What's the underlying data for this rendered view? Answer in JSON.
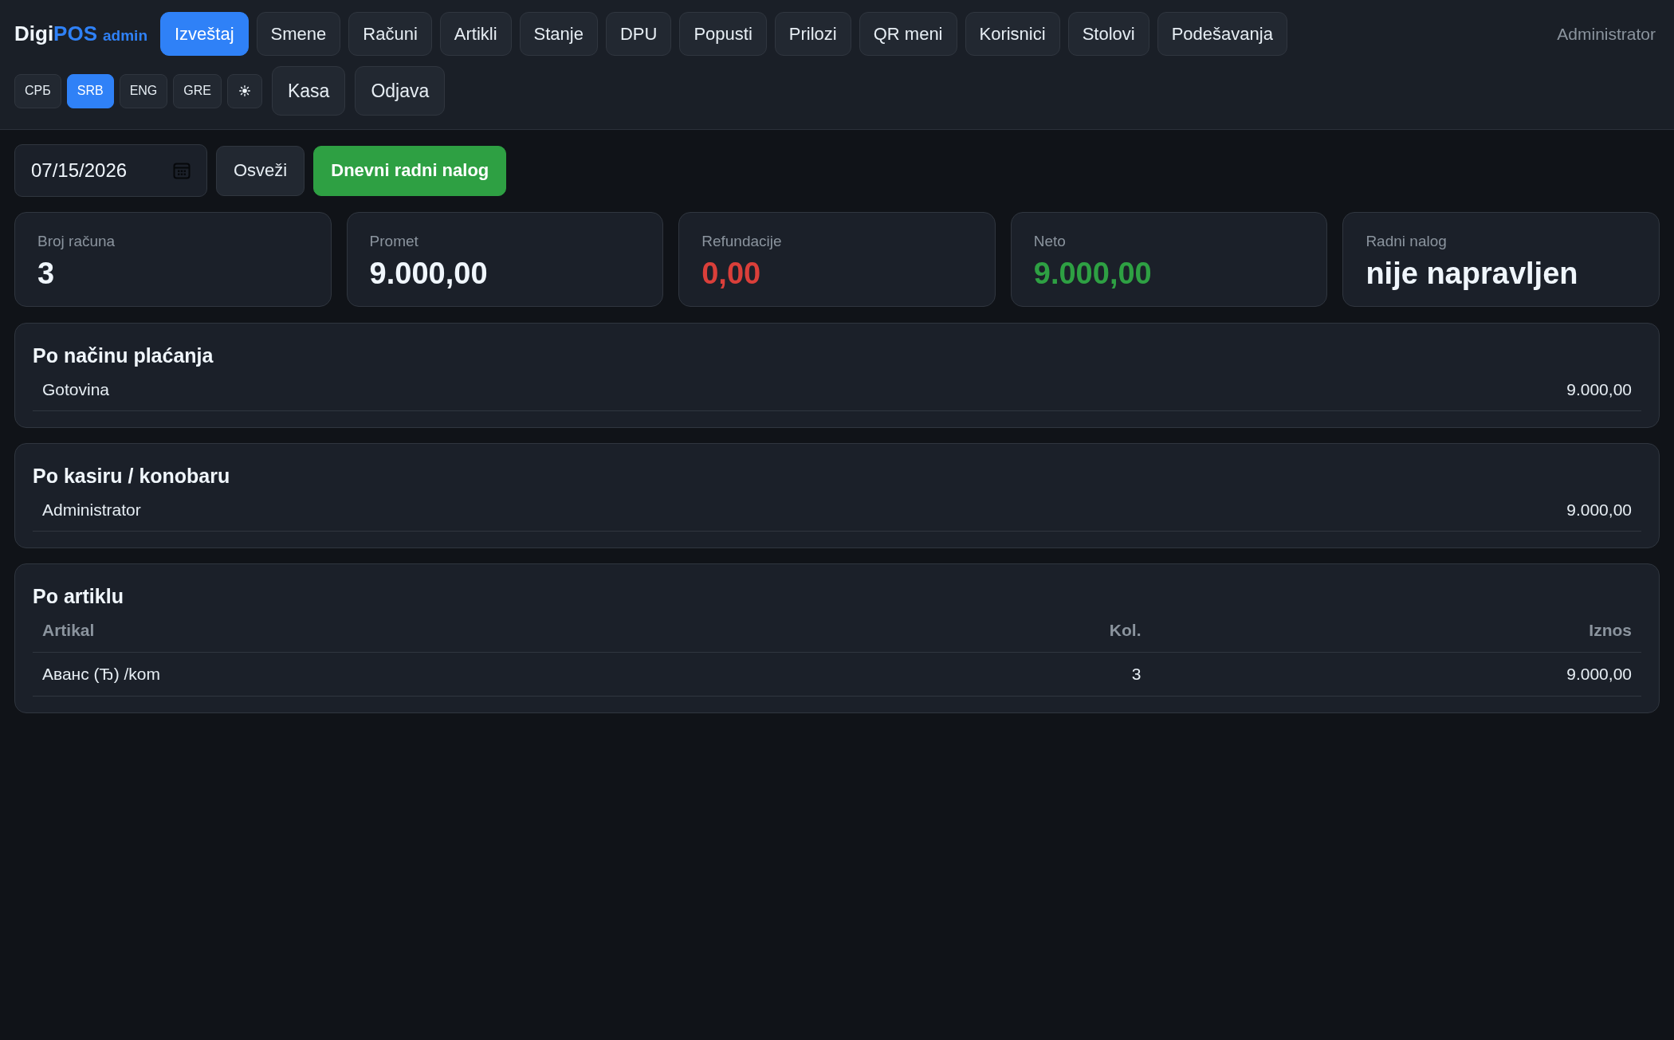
{
  "brand": {
    "name": "Digi",
    "highlight": "POS",
    "suffix": "admin"
  },
  "nav_tabs": [
    {
      "label": "Izveštaj",
      "selected": true
    },
    {
      "label": "Smene",
      "selected": false
    },
    {
      "label": "Računi",
      "selected": false
    },
    {
      "label": "Artikli",
      "selected": false
    },
    {
      "label": "Stanje",
      "selected": false
    },
    {
      "label": "DPU",
      "selected": false
    },
    {
      "label": "Popusti",
      "selected": false
    },
    {
      "label": "Prilozi",
      "selected": false
    },
    {
      "label": "QR meni",
      "selected": false
    },
    {
      "label": "Korisnici",
      "selected": false
    },
    {
      "label": "Stolovi",
      "selected": false
    },
    {
      "label": "Podešavanja",
      "selected": false
    }
  ],
  "user": "Administrator",
  "languages": [
    {
      "label": "СРБ",
      "selected": false
    },
    {
      "label": "SRB",
      "selected": true
    },
    {
      "label": "ENG",
      "selected": false
    },
    {
      "label": "GRE",
      "selected": false
    }
  ],
  "header_buttons": [
    "Kasa",
    "Odjava"
  ],
  "toolbar": {
    "date": "07/15/2026",
    "buttons": [
      {
        "label": "Osveži",
        "kind": "secondary"
      },
      {
        "label": "Dnevni radni nalog",
        "kind": "primary"
      }
    ]
  },
  "stats": [
    {
      "label": "Broj računa",
      "value": "3",
      "color": "#f0f6fc"
    },
    {
      "label": "Promet",
      "value": "9.000,00",
      "color": "#f0f6fc"
    },
    {
      "label": "Refundacije",
      "value": "0,00",
      "color": "#da3f3a"
    },
    {
      "label": "Neto",
      "value": "9.000,00",
      "color": "#2ea043"
    },
    {
      "label": "Radni nalog",
      "value": "nije napravljen",
      "color": "#f0f6fc"
    }
  ],
  "sections": [
    {
      "title": "Po načinu plaćanja",
      "kind": "list",
      "rows": [
        {
          "label": "Gotovina",
          "amount": "9.000,00"
        }
      ]
    },
    {
      "title": "Po kasiru / konobaru",
      "kind": "list",
      "rows": [
        {
          "label": "Administrator",
          "amount": "9.000,00"
        }
      ]
    },
    {
      "title": "Po artiklu",
      "kind": "table",
      "columns": [
        "Artikal",
        "Kol.",
        "Iznos"
      ],
      "rows": [
        [
          "Аванс (Ђ) /kom",
          "3",
          "9.000,00"
        ]
      ]
    }
  ]
}
